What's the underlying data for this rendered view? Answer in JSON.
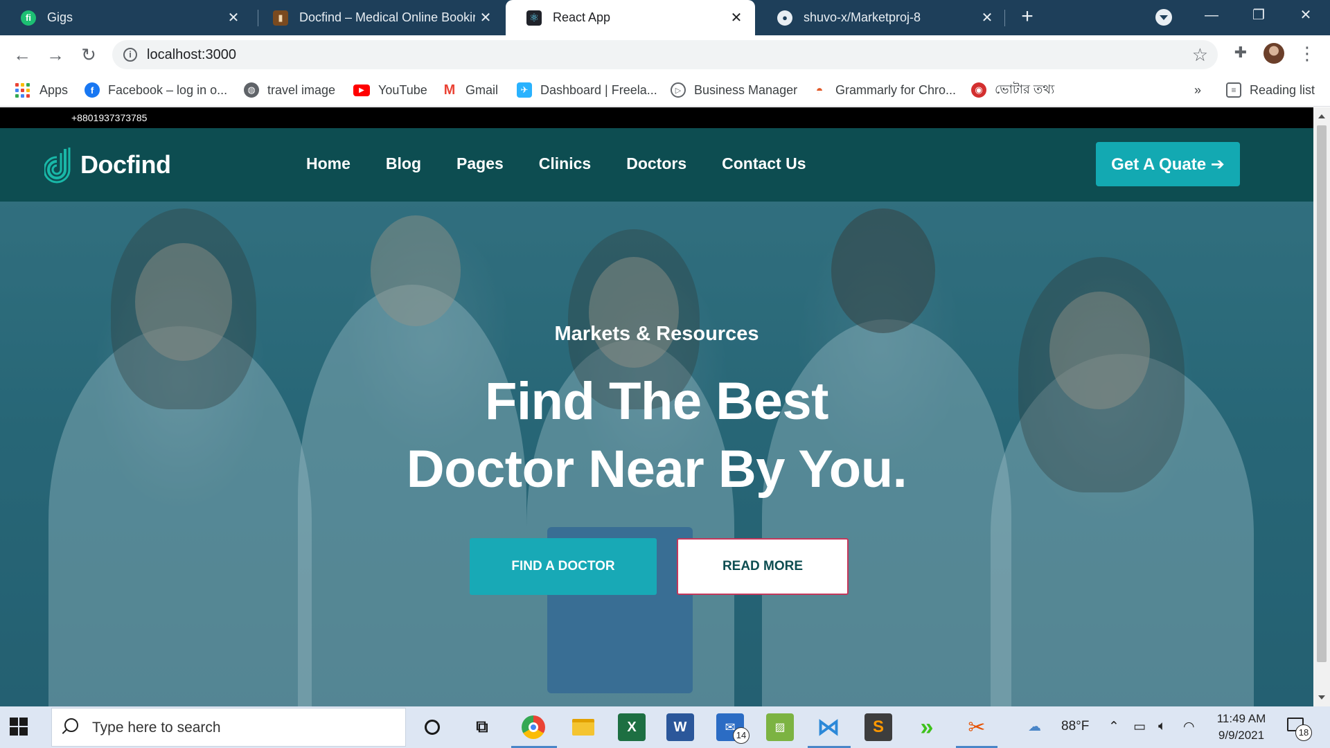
{
  "browser": {
    "tabs": [
      {
        "label": "Gigs",
        "favicon": "fiverr-icon",
        "active": false
      },
      {
        "label": "Docfind – Medical Online Booking",
        "favicon": "docfind-favicon",
        "active": false
      },
      {
        "label": "React App",
        "favicon": "react-icon",
        "active": true
      },
      {
        "label": "shuvo-x/Marketproj-8",
        "favicon": "github-icon",
        "active": false
      }
    ],
    "new_tab_symbol": "+",
    "address": {
      "url": "localhost:3000"
    },
    "bookmarks": [
      {
        "label": "Apps",
        "icon": "apps-grid-icon"
      },
      {
        "label": "Facebook – log in o...",
        "icon": "facebook-icon"
      },
      {
        "label": "travel image",
        "icon": "globe-icon"
      },
      {
        "label": "YouTube",
        "icon": "youtube-icon"
      },
      {
        "label": "Gmail",
        "icon": "gmail-icon"
      },
      {
        "label": "Dashboard | Freela...",
        "icon": "freelancer-icon"
      },
      {
        "label": "Business Manager",
        "icon": "business-manager-icon"
      },
      {
        "label": "Grammarly for Chro...",
        "icon": "grammarly-icon"
      },
      {
        "label": "ভোটার তথ্য",
        "icon": "election-commission-icon"
      }
    ],
    "bookmarks_overflow": "»",
    "reading_list": "Reading list"
  },
  "site": {
    "topbar_phone": "+8801937373785",
    "brand": "Docfind",
    "nav": [
      "Home",
      "Blog",
      "Pages",
      "Clinics",
      "Doctors",
      "Contact Us"
    ],
    "cta": "Get A Quate ➔",
    "hero": {
      "subtitle": "Markets & Resources",
      "title_line1": "Find The Best",
      "title_line2": "Doctor Near By You.",
      "primary_button": "FIND A DOCTOR",
      "secondary_button": "READ MORE"
    }
  },
  "taskbar": {
    "search_placeholder": "Type here to search",
    "mail_badge": "14",
    "weather": "88°F",
    "time": "11:49 AM",
    "date": "9/9/2021",
    "notification_count": "18"
  },
  "colors": {
    "brand_dark": "#0d4d51",
    "accent": "#18a9b6",
    "read_more_border": "#c4375b",
    "chrome_frame": "#1e3f5a"
  }
}
